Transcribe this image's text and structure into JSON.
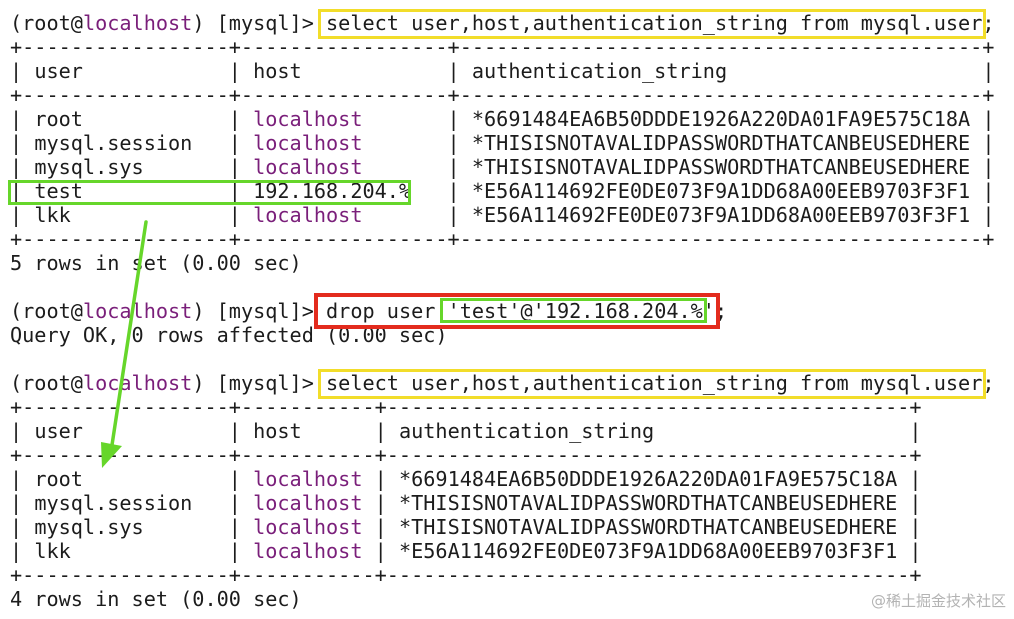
{
  "prompt": {
    "open": "(root@",
    "host": "localhost",
    "close": ") [mysql]> "
  },
  "commands": {
    "select": "select user,host,authentication_string from mysql.user;",
    "drop_prefix": "drop user ",
    "drop_target": "'test'@'192.168.204.%'",
    "drop_suffix": ";"
  },
  "table1": {
    "border": "+-----------------+-----------------+-------------------------------------------+",
    "header": {
      "pre": "| ",
      "user": "user           ",
      "sep1": " | ",
      "host": "host           ",
      "sep2": " | ",
      "auth": "authentication_string                    ",
      "end": " |"
    },
    "rows": [
      {
        "pre": "| ",
        "user": "root           ",
        "sep1": " | ",
        "host": "localhost      ",
        "sep2": " | ",
        "auth": "*6691484EA6B50DDDE1926A220DA01FA9E575C18A",
        "end": " |"
      },
      {
        "pre": "| ",
        "user": "mysql.session  ",
        "sep1": " | ",
        "host": "localhost      ",
        "sep2": " | ",
        "auth": "*THISISNOTAVALIDPASSWORDTHATCANBEUSEDHERE",
        "end": " |"
      },
      {
        "pre": "| ",
        "user": "mysql.sys      ",
        "sep1": " | ",
        "host": "localhost      ",
        "sep2": " | ",
        "auth": "*THISISNOTAVALIDPASSWORDTHATCANBEUSEDHERE",
        "end": " |"
      },
      {
        "pre": "| ",
        "user": "test           ",
        "sep1": " | ",
        "host": "192.168.204.%  ",
        "sep2": " | ",
        "auth": "*E56A114692FE0DE073F9A1DD68A00EEB9703F3F1",
        "end": " |"
      },
      {
        "pre": "| ",
        "user": "lkk            ",
        "sep1": " | ",
        "host": "localhost      ",
        "sep2": " | ",
        "auth": "*E56A114692FE0DE073F9A1DD68A00EEB9703F3F1",
        "end": " |"
      }
    ],
    "summary": "5 rows in set (0.00 sec)"
  },
  "drop_result": "Query OK, 0 rows affected (0.00 sec)",
  "table2": {
    "border": "+-----------------+-----------+-------------------------------------------+",
    "header": {
      "pre": "| ",
      "user": "user           ",
      "sep1": " | ",
      "host": "host     ",
      "sep2": " | ",
      "auth": "authentication_string                    ",
      "end": " |"
    },
    "rows": [
      {
        "pre": "| ",
        "user": "root           ",
        "sep1": " | ",
        "host": "localhost",
        "sep2": " | ",
        "auth": "*6691484EA6B50DDDE1926A220DA01FA9E575C18A",
        "end": " |"
      },
      {
        "pre": "| ",
        "user": "mysql.session  ",
        "sep1": " | ",
        "host": "localhost",
        "sep2": " | ",
        "auth": "*THISISNOTAVALIDPASSWORDTHATCANBEUSEDHERE",
        "end": " |"
      },
      {
        "pre": "| ",
        "user": "mysql.sys      ",
        "sep1": " | ",
        "host": "localhost",
        "sep2": " | ",
        "auth": "*THISISNOTAVALIDPASSWORDTHATCANBEUSEDHERE",
        "end": " |"
      },
      {
        "pre": "| ",
        "user": "lkk            ",
        "sep1": " | ",
        "host": "localhost",
        "sep2": " | ",
        "auth": "*E56A114692FE0DE073F9A1DD68A00EEB9703F3F1",
        "end": " |"
      }
    ],
    "summary": "4 rows in set (0.00 sec)"
  },
  "watermark": "@稀土掘金技术社区",
  "colors": {
    "host_purple": "#7a1f7a",
    "highlight_yellow": "#f2dd2a",
    "highlight_red": "#e32b1d",
    "highlight_green": "#66d62a",
    "arrow_green": "#66d62a"
  }
}
